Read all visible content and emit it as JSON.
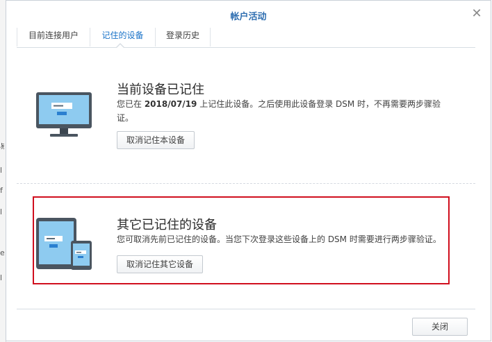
{
  "dialog": {
    "title": "帐户活动",
    "close_icon": "close-icon"
  },
  "tabs": [
    {
      "label": "目前连接用户",
      "active": false
    },
    {
      "label": "记住的设备",
      "active": true
    },
    {
      "label": "登录历史",
      "active": false
    }
  ],
  "current_device": {
    "heading": "当前设备已记住",
    "desc_prefix": "您已在 ",
    "date": "2018/07/19",
    "desc_suffix": " 上记住此设备。之后使用此设备登录 DSM 时，不再需要两步骤验证。",
    "button": "取消记住本设备",
    "icon": "monitor-icon"
  },
  "other_devices": {
    "heading": "其它已记住的设备",
    "desc": "您可取消先前已记住的设备。当您下次登录这些设备上的 DSM 时需要进行两步骤验证。",
    "button": "取消记住其它设备",
    "icon": "tablet-phone-icon"
  },
  "footer": {
    "close_button": "关闭"
  },
  "colors": {
    "title_blue": "#2e6eb0",
    "active_tab": "#1a73c8",
    "highlight_red": "#d00e1d",
    "screen_blue": "#8ecbf0"
  }
}
